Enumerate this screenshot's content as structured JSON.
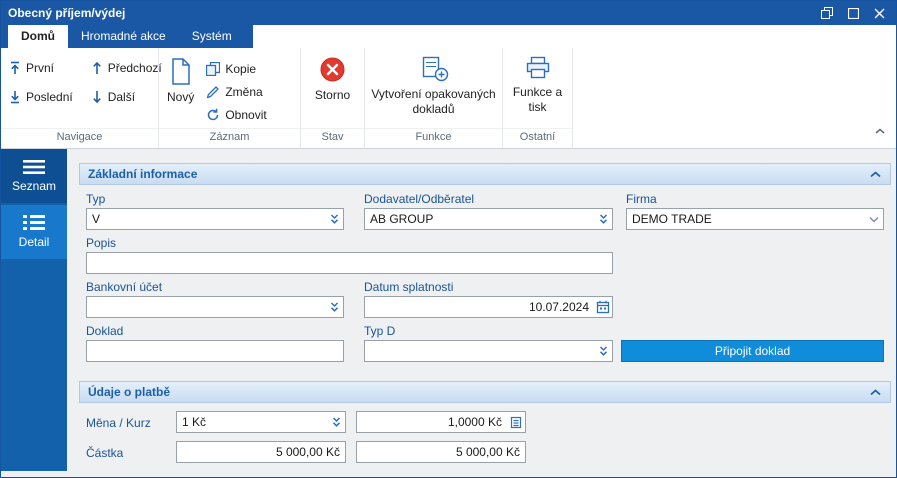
{
  "window": {
    "title": "Obecný příjem/výdej"
  },
  "tabs": [
    {
      "label": "Domů"
    },
    {
      "label": "Hromadné akce"
    },
    {
      "label": "Systém"
    }
  ],
  "ribbon": {
    "navigace": {
      "caption": "Navigace",
      "first": "První",
      "prev": "Předchozí",
      "last": "Poslední",
      "next": "Další"
    },
    "zaznam": {
      "caption": "Záznam",
      "new": "Nový",
      "copy": "Kopie",
      "edit": "Změna",
      "refresh": "Obnovit"
    },
    "stav": {
      "caption": "Stav",
      "storno": "Storno"
    },
    "funkce": {
      "caption": "Funkce",
      "repeat_docs": "Vytvoření opakovaných dokladů"
    },
    "ostatni": {
      "caption": "Ostatní",
      "print": "Funkce a tisk"
    }
  },
  "sidebar": {
    "seznam": "Seznam",
    "detail": "Detail"
  },
  "basic": {
    "title": "Základní informace",
    "typ_label": "Typ",
    "typ_value": "V",
    "partner_label": "Dodavatel/Odběratel",
    "partner_value": "AB GROUP",
    "firma_label": "Firma",
    "firma_value": "DEMO TRADE",
    "popis_label": "Popis",
    "popis_value": "",
    "ucet_label": "Bankovní účet",
    "ucet_value": "",
    "datum_label": "Datum splatnosti",
    "datum_value": "10.07.2024",
    "doklad_label": "Doklad",
    "doklad_value": "",
    "typd_label": "Typ D",
    "typd_value": "",
    "attach_button": "Připojit doklad"
  },
  "platba": {
    "title": "Údaje o platbě",
    "mena_label": "Měna / Kurz",
    "mena_value": "1 Kč",
    "kurz_value": "1,0000 Kč",
    "castka_label": "Částka",
    "castka_value": "5 000,00 Kč",
    "castka_value2": "5 000,00 Kč"
  },
  "colors": {
    "accent": "#1a57a4",
    "selected_sidebar": "#1879cc",
    "attach_button": "#0f8cda",
    "storno_red": "#e23a2e"
  }
}
